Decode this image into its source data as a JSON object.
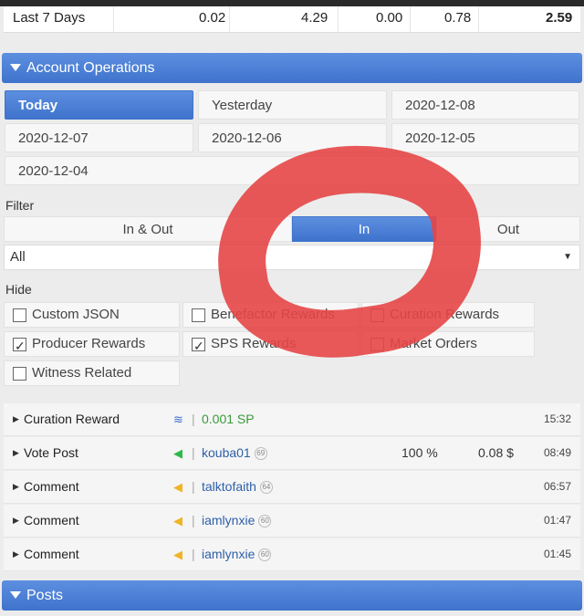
{
  "stats": {
    "label": "Last 7 Days",
    "values": [
      "0.02",
      "4.29",
      "0.00",
      "0.78",
      "2.59"
    ]
  },
  "account_operations": {
    "title": "Account Operations",
    "dates": [
      "Today",
      "Yesterday",
      "2020-12-08",
      "2020-12-07",
      "2020-12-06",
      "2020-12-05",
      "2020-12-04"
    ],
    "selected_date": "Today",
    "filter_label": "Filter",
    "filter_segments": [
      "In & Out",
      "In",
      "Out"
    ],
    "selected_segment": "In",
    "select_value": "All",
    "hide_label": "Hide",
    "hide_options": [
      {
        "label": "Custom JSON",
        "checked": false
      },
      {
        "label": "Benefactor Rewards",
        "checked": false
      },
      {
        "label": "Curation Rewards",
        "checked": false
      },
      {
        "label": "Producer Rewards",
        "checked": true
      },
      {
        "label": "SPS Rewards",
        "checked": true
      },
      {
        "label": "Market Orders",
        "checked": false
      },
      {
        "label": "Witness Related",
        "checked": false
      }
    ],
    "operations": [
      {
        "type": "Curation Reward",
        "detail": "0.001 SP",
        "time": "15:32"
      },
      {
        "type": "Vote Post",
        "user": "kouba01",
        "rep": "69",
        "pct": "100 %",
        "amount": "0.08 $",
        "time": "08:49"
      },
      {
        "type": "Comment",
        "user": "talktofaith",
        "rep": "64",
        "time": "06:57"
      },
      {
        "type": "Comment",
        "user": "iamlynxie",
        "rep": "60",
        "time": "01:47"
      },
      {
        "type": "Comment",
        "user": "iamlynxie",
        "rep": "60",
        "time": "01:45"
      }
    ]
  },
  "posts": {
    "title": "Posts"
  },
  "colors": {
    "accent": "#4a7fd6",
    "annotation": "#e64646"
  }
}
